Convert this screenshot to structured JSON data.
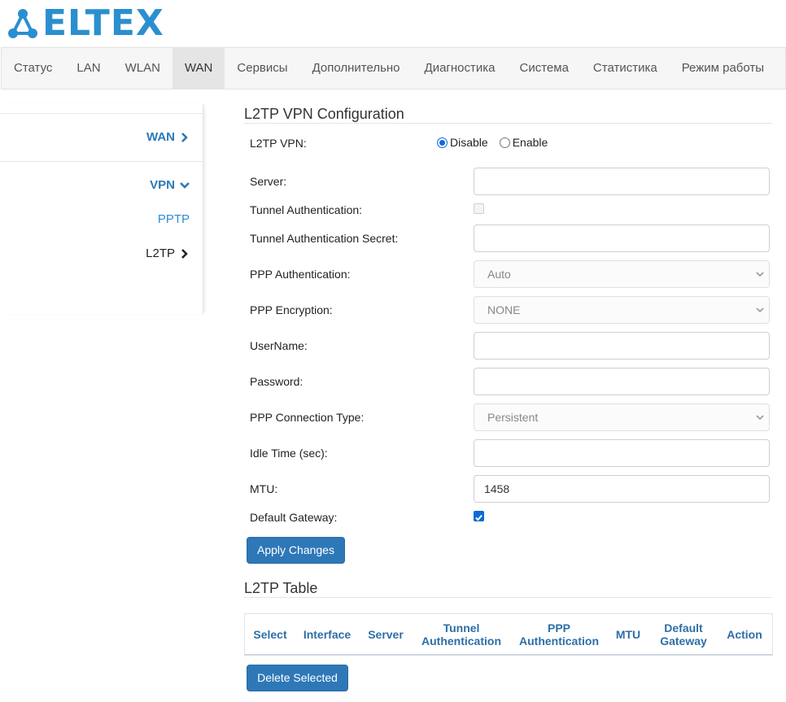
{
  "brand": {
    "logo_text": "ELTEX"
  },
  "nav": {
    "items": [
      {
        "label": "Статус"
      },
      {
        "label": "LAN"
      },
      {
        "label": "WLAN"
      },
      {
        "label": "WAN"
      },
      {
        "label": "Сервисы"
      },
      {
        "label": "Дополнительно"
      },
      {
        "label": "Диагностика"
      },
      {
        "label": "Система"
      },
      {
        "label": "Статистика"
      },
      {
        "label": "Режим работы"
      }
    ],
    "active": "WAN"
  },
  "sidebar": {
    "items": [
      {
        "label": "WAN"
      },
      {
        "label": "VPN"
      },
      {
        "label": "PPTP"
      },
      {
        "label": "L2TP"
      }
    ]
  },
  "config": {
    "title": "L2TP VPN Configuration",
    "l2tp_vpn_label": "L2TP VPN:",
    "radio_disable": "Disable",
    "radio_enable": "Enable",
    "l2tp_vpn_value": "Disable",
    "server_label": "Server:",
    "server_value": "",
    "tunnel_auth_label": "Tunnel Authentication:",
    "tunnel_auth_checked": false,
    "tunnel_secret_label": "Tunnel Authentication Secret:",
    "tunnel_secret_value": "",
    "ppp_auth_label": "PPP Authentication:",
    "ppp_auth_value": "Auto",
    "ppp_enc_label": "PPP Encryption:",
    "ppp_enc_value": "NONE",
    "username_label": "UserName:",
    "username_value": "",
    "password_label": "Password:",
    "password_value": "",
    "conn_type_label": "PPP Connection Type:",
    "conn_type_value": "Persistent",
    "idle_label": "Idle Time (sec):",
    "idle_value": "",
    "mtu_label": "MTU:",
    "mtu_value": "1458",
    "gateway_label": "Default Gateway:",
    "gateway_checked": true,
    "apply_button": "Apply Changes"
  },
  "table": {
    "title": "L2TP Table",
    "headers": [
      {
        "line1": "Select",
        "line2": ""
      },
      {
        "line1": "Interface",
        "line2": ""
      },
      {
        "line1": "Server",
        "line2": ""
      },
      {
        "line1": "Tunnel",
        "line2": "Authentication"
      },
      {
        "line1": "PPP",
        "line2": "Authentication"
      },
      {
        "line1": "MTU",
        "line2": ""
      },
      {
        "line1": "Default",
        "line2": "Gateway"
      },
      {
        "line1": "Action",
        "line2": ""
      }
    ],
    "delete_button": "Delete Selected"
  },
  "colors": {
    "brand_blue": "#2a8fd0",
    "button_blue": "#2e78b8",
    "header_text": "#2d6ea8"
  }
}
